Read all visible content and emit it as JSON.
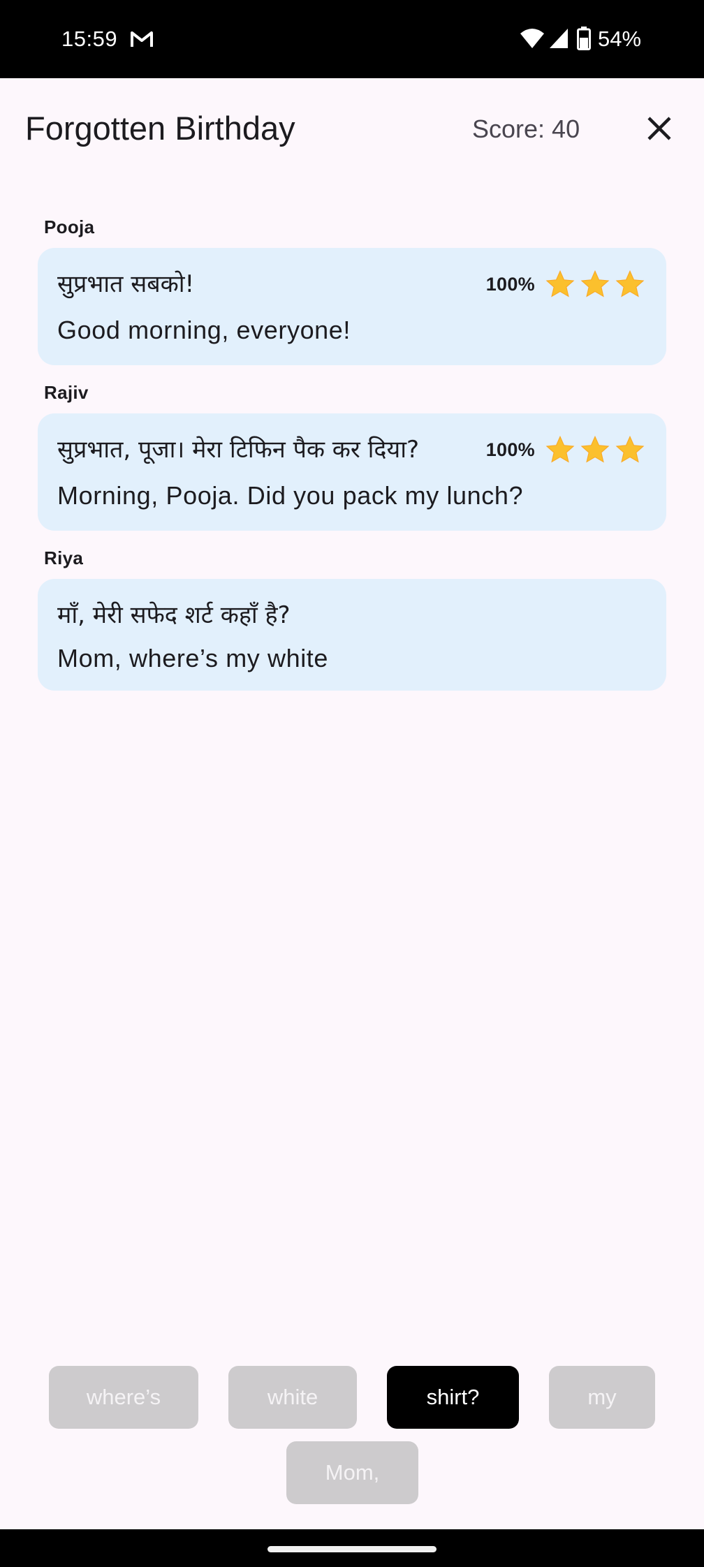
{
  "status_bar": {
    "time": "15:59",
    "battery": "54%",
    "icons": [
      "gmail-icon",
      "wifi-icon",
      "signal-icon",
      "battery-icon"
    ]
  },
  "header": {
    "title": "Forgotten Birthday",
    "score_label": "Score: 40"
  },
  "messages": [
    {
      "speaker": "Pooja",
      "hindi": "सुप्रभात सबको!",
      "english": "Good morning, everyone!",
      "score": "100%",
      "stars": 3
    },
    {
      "speaker": "Rajiv",
      "hindi": "सुप्रभात, पूजा। मेरा टिफिन पैक कर दिया?",
      "english": "Morning, Pooja. Did you pack my lunch?",
      "score": "100%",
      "stars": 3
    },
    {
      "speaker": "Riya",
      "hindi": "माँ, मेरी सफेद शर्ट कहाँ है?",
      "english": "Mom, where’s my white"
    }
  ],
  "word_bank": [
    {
      "label": "where’s",
      "state": "used"
    },
    {
      "label": "white",
      "state": "used"
    },
    {
      "label": "shirt?",
      "state": "available"
    },
    {
      "label": "my",
      "state": "used"
    },
    {
      "label": "Mom,",
      "state": "used"
    }
  ],
  "colors": {
    "background": "#fdf7fc",
    "bubble": "#e2f0fc",
    "chip_used": "#cdcbcd",
    "chip_active": "#000000",
    "star": "#fbc02d"
  }
}
